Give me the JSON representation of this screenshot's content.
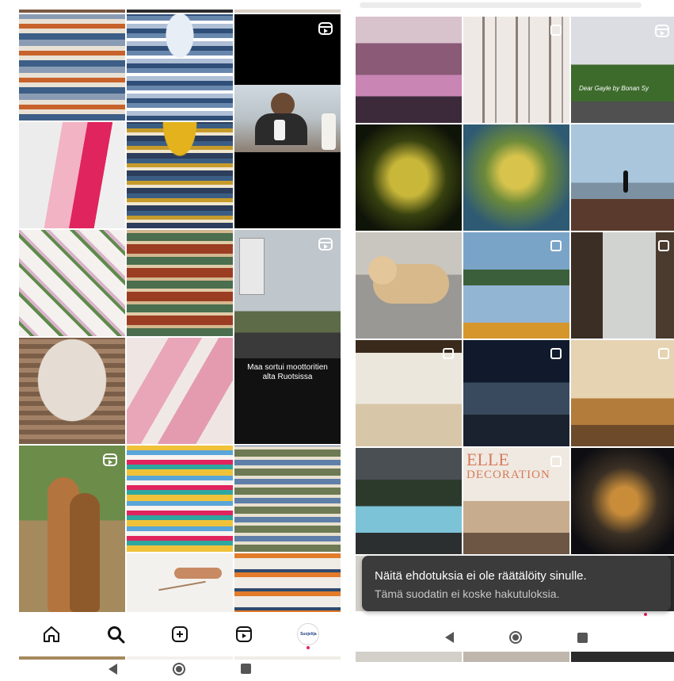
{
  "left": {
    "reel_overlay_text": "Maa sortui moottoritien alta Ruotsissa",
    "profile_avatar_label": "Suojelija",
    "nav": [
      "home-icon",
      "search-icon",
      "create-icon",
      "reels-icon",
      "profile-avatar"
    ]
  },
  "right": {
    "toast": {
      "title": "Näitä ehdotuksia ei ole räätälöity sinulle.",
      "subtitle": "Tämä suodatin ei koske hakutuloksia."
    },
    "tile_caption_3": "Dear Gayle by Bonan Sy",
    "magazine_title": "DECORATION",
    "magazine_brand": "ELLE"
  },
  "colors": {
    "accent": "#e0245e",
    "toast_bg": "#3b3b3b"
  }
}
